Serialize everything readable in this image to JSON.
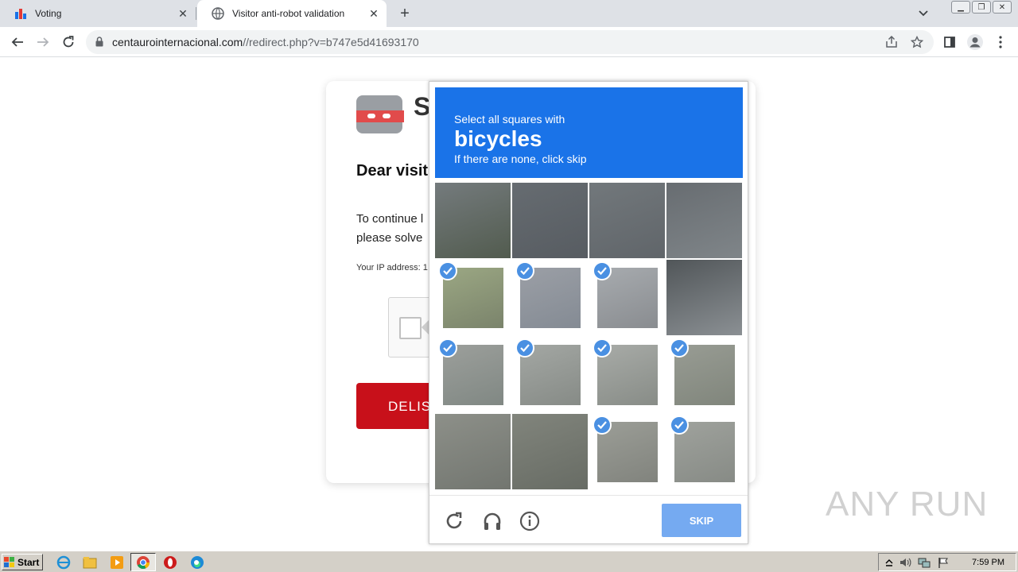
{
  "browser": {
    "tabs": [
      {
        "title": "Voting",
        "active": false
      },
      {
        "title": "Visitor anti-robot validation",
        "active": true
      }
    ],
    "url_host": "centaurointernacional.com",
    "url_path": "//redirect.php?v=b747e5d41693170"
  },
  "page": {
    "logo_letter": "S",
    "heading": "Dear visit",
    "para_line1": "To continue l",
    "para_line2": "please solve",
    "ip_label": "Your IP address: 1",
    "button_label": "DELIS"
  },
  "captcha": {
    "header_line1": "Select all squares with",
    "header_target": "bicycles",
    "header_line3": "If there are none, click skip",
    "tiles": [
      {
        "selected": false
      },
      {
        "selected": false
      },
      {
        "selected": false
      },
      {
        "selected": false
      },
      {
        "selected": true
      },
      {
        "selected": true
      },
      {
        "selected": true
      },
      {
        "selected": false
      },
      {
        "selected": true
      },
      {
        "selected": true
      },
      {
        "selected": true
      },
      {
        "selected": true
      },
      {
        "selected": false
      },
      {
        "selected": false
      },
      {
        "selected": true
      },
      {
        "selected": true
      }
    ],
    "skip_label": "SKIP",
    "accent_color": "#1a73e8"
  },
  "watermark": "ANY RUN",
  "taskbar": {
    "start_label": "Start",
    "clock": "7:59 PM"
  }
}
